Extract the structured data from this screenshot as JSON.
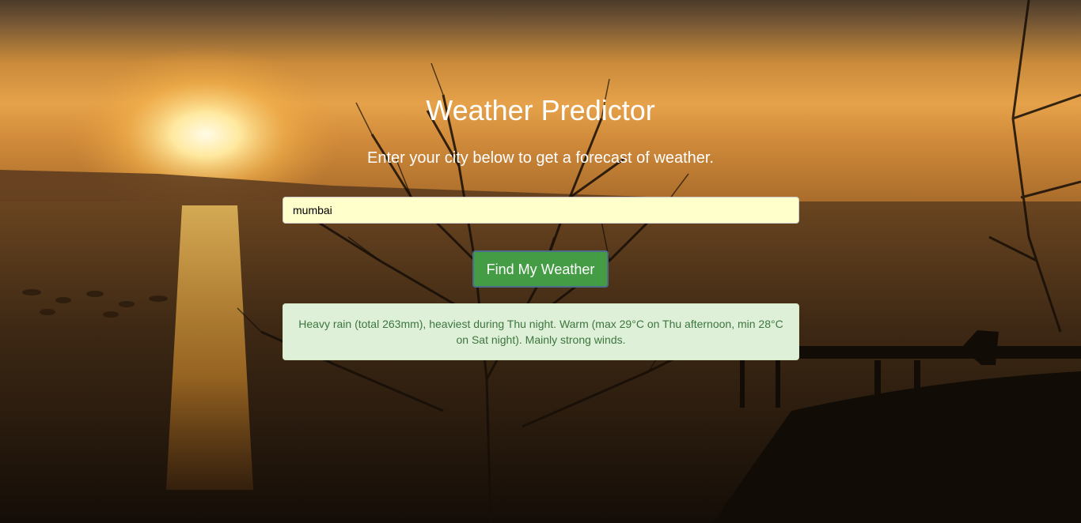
{
  "page": {
    "title": "Weather Predictor",
    "subtitle": "Enter your city below to get a forecast of weather."
  },
  "search": {
    "value": "mumbai",
    "button_label": "Find My Weather"
  },
  "result": {
    "text": "Heavy rain (total 263mm), heaviest during Thu night. Warm (max 29°C on Thu afternoon, min 28°C on Sat night). Mainly strong winds."
  },
  "colors": {
    "button": "#449d44",
    "input_background": "#ffffcc",
    "result_background": "#dff0d8",
    "result_text": "#3c763d"
  }
}
